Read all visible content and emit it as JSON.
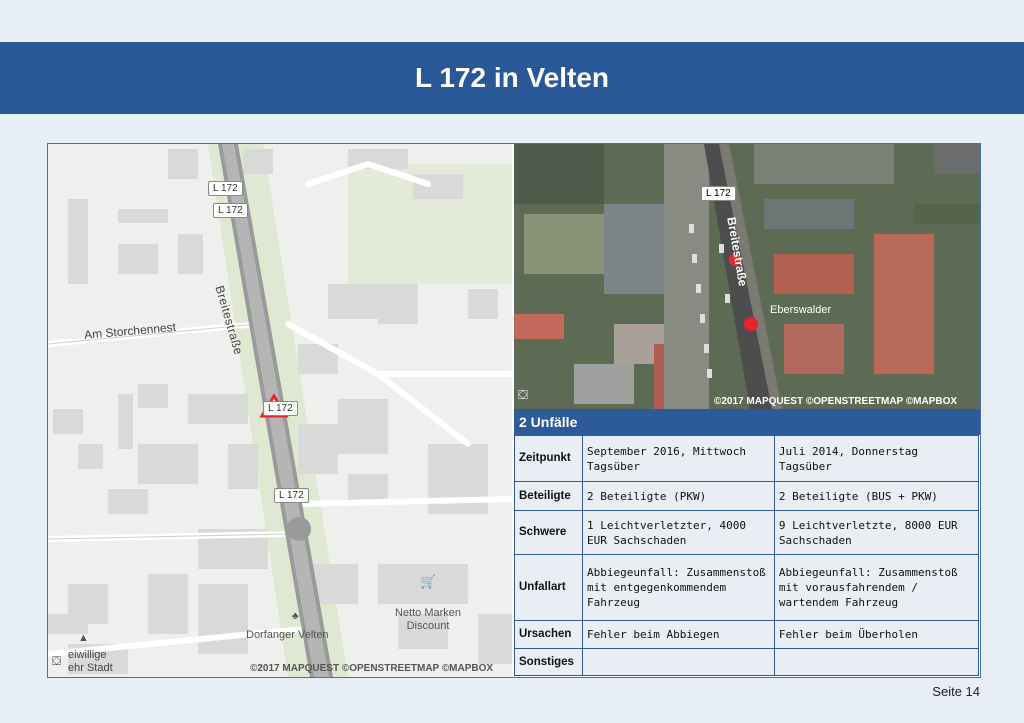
{
  "title": "L 172 in Velten",
  "page_label": "Seite 14",
  "map": {
    "road_labels": [
      "L 172",
      "L 172",
      "L 172",
      "L 172"
    ],
    "street_name": "Breitestraße",
    "street_am_storchennest": "Am Storchennest",
    "poi_netto_line1": "Netto Marken",
    "poi_netto_line2": "Discount",
    "poi_dorfanger": "Dorfanger Velten",
    "poi_feuerwehr_line1": "eiwillige",
    "poi_feuerwehr_line2": "ehr Stadt",
    "attribution": "©2017 MAPQUEST ©OPENSTREETMAP ©MAPBOX"
  },
  "satellite": {
    "road_label": "L 172",
    "street_name": "Breitestraße",
    "poi_eberswalder": "Eberswalder",
    "attribution": "©2017 MAPQUEST ©OPENSTREETMAP ©MAPBOX"
  },
  "accidents": {
    "header": "2 Unfälle",
    "rows": [
      {
        "label": "Zeitpunkt",
        "a": "September 2016, Mittwoch Tagsüber",
        "b": "Juli 2014, Donnerstag Tagsüber"
      },
      {
        "label": "Beteiligte",
        "a": "2 Beteiligte (PKW)",
        "b": "2 Beteiligte (BUS + PKW)"
      },
      {
        "label": "Schwere",
        "a": "1 Leichtverletzter, 4000 EUR Sachschaden",
        "b": "9 Leichtverletzte, 8000 EUR Sachschaden"
      },
      {
        "label": "Unfallart",
        "a": "Abbiegeunfall: Zusammenstoß mit entgegenkommendem Fahrzeug",
        "b": "Abbiegeunfall: Zusammenstoß mit vorausfahrendem / wartendem Fahrzeug"
      },
      {
        "label": "Ursachen",
        "a": "Fehler beim Abbiegen",
        "b": "Fehler beim Überholen"
      },
      {
        "label": "Sonstiges",
        "a": "",
        "b": ""
      }
    ]
  },
  "colors": {
    "title_bar": "#2a5796",
    "table_border": "#2d5a98",
    "marker_red": "#e8232c"
  }
}
